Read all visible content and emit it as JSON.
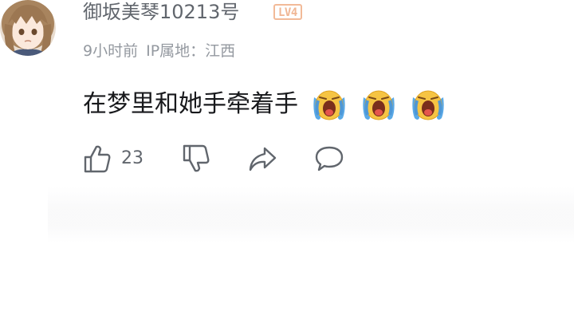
{
  "comment": {
    "username": "御坂美琴10213号",
    "level_badge": "LV4",
    "time": "9小时前",
    "ip_location": "IP属地：江西",
    "text": "在梦里和她手牵着手",
    "emojis": [
      "crying-emoji",
      "crying-emoji",
      "crying-emoji"
    ],
    "likes": "23"
  },
  "colors": {
    "username": "#61666d",
    "meta": "#9499a0",
    "text": "#18191c",
    "level_badge": "#f0b694",
    "icon_stroke": "#61666d"
  },
  "icons": {
    "like": "thumbs-up-icon",
    "dislike": "thumbs-down-icon",
    "share": "share-icon",
    "reply": "comment-bubble-icon"
  }
}
